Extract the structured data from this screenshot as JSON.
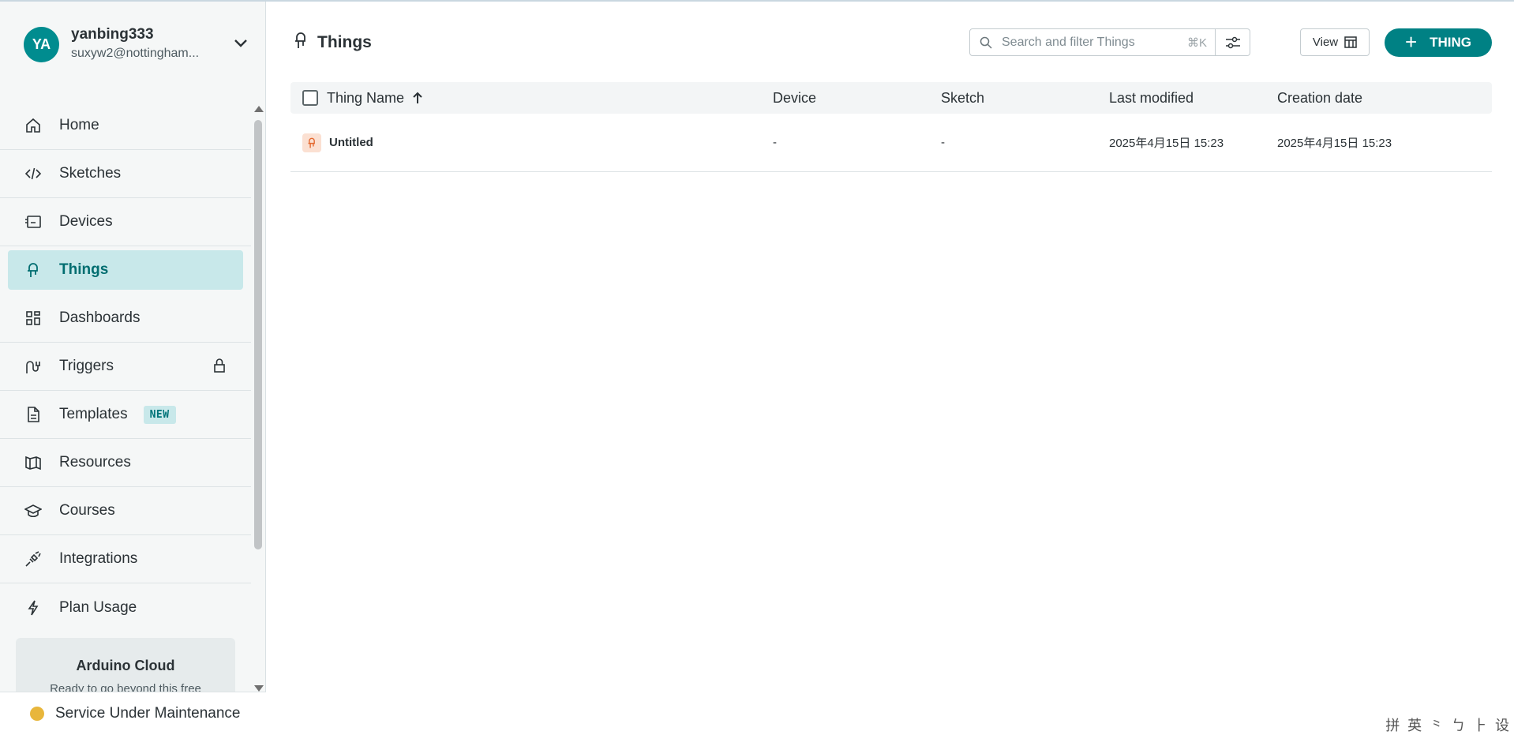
{
  "account": {
    "initials": "YA",
    "name": "yanbing333",
    "email": "suxyw2@nottingham..."
  },
  "sidebar": {
    "items": [
      {
        "label": "Home",
        "icon": "home-icon"
      },
      {
        "label": "Sketches",
        "icon": "code-icon"
      },
      {
        "label": "Devices",
        "icon": "device-icon"
      },
      {
        "label": "Things",
        "icon": "thing-icon",
        "active": true
      },
      {
        "label": "Dashboards",
        "icon": "dashboard-icon"
      },
      {
        "label": "Triggers",
        "icon": "trigger-icon",
        "locked": true
      },
      {
        "label": "Templates",
        "icon": "template-icon",
        "badge": "NEW"
      },
      {
        "label": "Resources",
        "icon": "book-icon"
      },
      {
        "label": "Courses",
        "icon": "graduation-cap-icon"
      },
      {
        "label": "Integrations",
        "icon": "plug-icon"
      },
      {
        "label": "Plan Usage",
        "icon": "lightning-icon"
      }
    ],
    "promo": {
      "title": "Arduino Cloud",
      "text": "Ready to go beyond this free"
    },
    "status": {
      "text": "Service Under Maintenance",
      "color": "#e8b63b"
    }
  },
  "header": {
    "title": "Things",
    "search_placeholder": "Search and filter Things",
    "shortcut": "⌘K",
    "view_label": "View",
    "add_label": "THING"
  },
  "table": {
    "columns": {
      "name": "Thing Name",
      "device": "Device",
      "sketch": "Sketch",
      "modified": "Last modified",
      "created": "Creation date"
    },
    "rows": [
      {
        "name": "Untitled",
        "device": "-",
        "sketch": "-",
        "modified": "2025年4月15日 15:23",
        "created": "2025年4月15日 15:23"
      }
    ]
  },
  "ime_bar": "拼 英 ⺀ ㄅ ⺊ 设"
}
